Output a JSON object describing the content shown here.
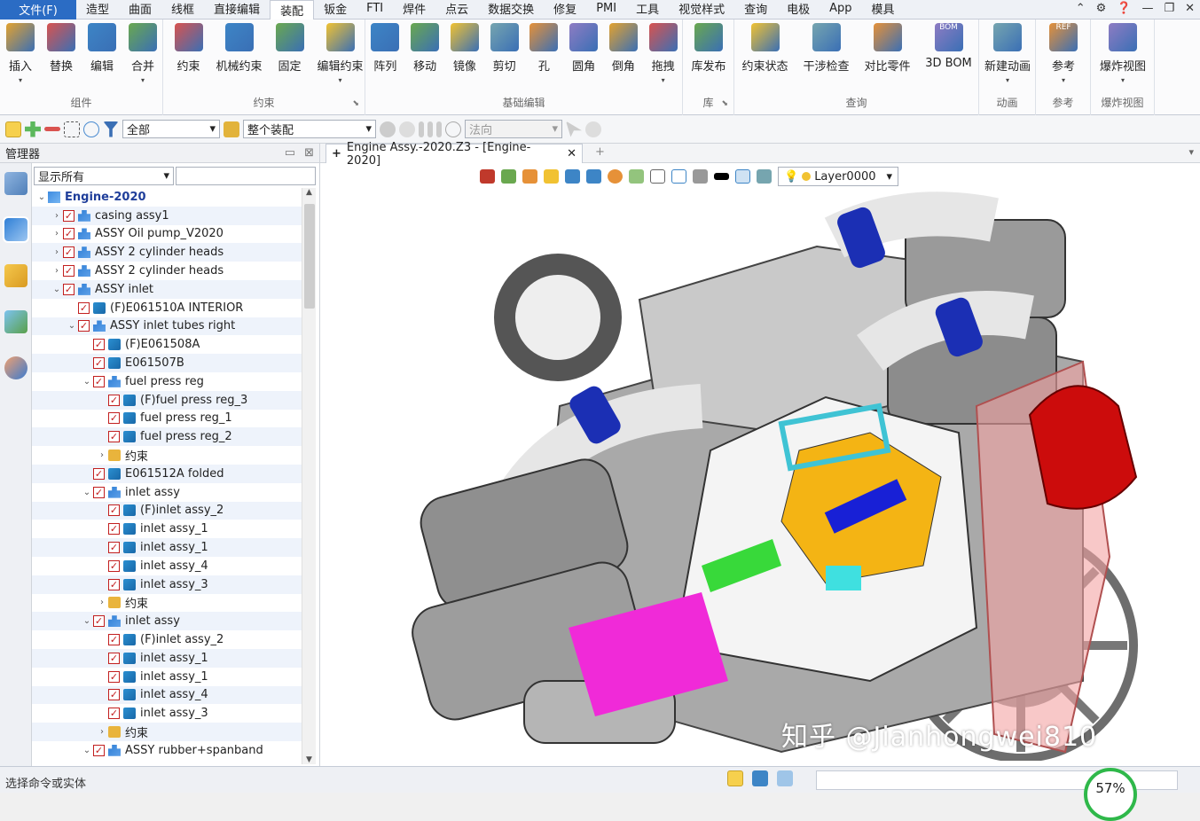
{
  "menubar": {
    "file": "文件(F)",
    "tabs": [
      "造型",
      "曲面",
      "线框",
      "直接编辑",
      "装配",
      "钣金",
      "FTI",
      "焊件",
      "点云",
      "数据交换",
      "修复",
      "PMI",
      "工具",
      "视觉样式",
      "查询",
      "电极",
      "App",
      "模具"
    ],
    "active_index": 4
  },
  "ribbon": {
    "groups": [
      {
        "label": "组件",
        "buttons": [
          "插入",
          "替换",
          "编辑",
          "合并"
        ]
      },
      {
        "label": "约束",
        "buttons": [
          "约束",
          "机械约束",
          "固定",
          "编辑约束"
        ]
      },
      {
        "label": "基础编辑",
        "buttons": [
          "阵列",
          "移动",
          "镜像",
          "剪切",
          "孔",
          "圆角",
          "倒角",
          "拖拽"
        ]
      },
      {
        "label": "库",
        "buttons": [
          "库发布"
        ]
      },
      {
        "label": "查询",
        "buttons": [
          "约束状态",
          "干涉检查",
          "对比零件",
          "3D BOM"
        ]
      },
      {
        "label": "动画",
        "buttons": [
          "新建动画"
        ]
      },
      {
        "label": "参考",
        "buttons": [
          "参考"
        ]
      },
      {
        "label": "爆炸视图",
        "buttons": [
          "爆炸视图"
        ]
      }
    ],
    "bom_icon_text": "BOM",
    "ref_icon_text": "REF"
  },
  "toolbar2": {
    "filter_value": "全部",
    "scope_value": "整个装配",
    "direction_placeholder": "法向"
  },
  "manager": {
    "title": "管理器",
    "filter_value": "显示所有"
  },
  "tree": [
    {
      "label": "Engine-2020",
      "level": 0,
      "icon": "root",
      "expand": "v",
      "check": false
    },
    {
      "label": "casing assy1",
      "level": 1,
      "icon": "assy",
      "expand": ">",
      "check": true
    },
    {
      "label": "ASSY Oil pump_V2020",
      "level": 1,
      "icon": "assy",
      "expand": ">",
      "check": true
    },
    {
      "label": "ASSY 2 cylinder heads",
      "level": 1,
      "icon": "assy",
      "expand": ">",
      "check": true
    },
    {
      "label": "ASSY 2 cylinder heads",
      "level": 1,
      "icon": "assy",
      "expand": ">",
      "check": true
    },
    {
      "label": "ASSY inlet",
      "level": 1,
      "icon": "assy",
      "expand": "v",
      "check": true
    },
    {
      "label": "(F)E061510A INTERIOR",
      "level": 2,
      "icon": "part",
      "expand": "",
      "check": true
    },
    {
      "label": "ASSY inlet tubes right",
      "level": 2,
      "icon": "assy",
      "expand": "v",
      "check": true
    },
    {
      "label": "(F)E061508A",
      "level": 3,
      "icon": "part",
      "expand": "",
      "check": true
    },
    {
      "label": "E061507B",
      "level": 3,
      "icon": "part",
      "expand": "",
      "check": true
    },
    {
      "label": "fuel press reg",
      "level": 3,
      "icon": "assy",
      "expand": "v",
      "check": true
    },
    {
      "label": "(F)fuel press reg_3",
      "level": 4,
      "icon": "part",
      "expand": "",
      "check": true
    },
    {
      "label": "fuel press reg_1",
      "level": 4,
      "icon": "part",
      "expand": "",
      "check": true
    },
    {
      "label": "fuel press reg_2",
      "level": 4,
      "icon": "part",
      "expand": "",
      "check": true
    },
    {
      "label": "约束",
      "level": 4,
      "icon": "folder",
      "expand": ">",
      "check": false
    },
    {
      "label": "E061512A folded",
      "level": 3,
      "icon": "part",
      "expand": "",
      "check": true
    },
    {
      "label": "inlet assy",
      "level": 3,
      "icon": "assy",
      "expand": "v",
      "check": true
    },
    {
      "label": "(F)inlet assy_2",
      "level": 4,
      "icon": "part",
      "expand": "",
      "check": true
    },
    {
      "label": "inlet assy_1",
      "level": 4,
      "icon": "part",
      "expand": "",
      "check": true
    },
    {
      "label": "inlet assy_1",
      "level": 4,
      "icon": "part",
      "expand": "",
      "check": true
    },
    {
      "label": "inlet assy_4",
      "level": 4,
      "icon": "part",
      "expand": "",
      "check": true
    },
    {
      "label": "inlet assy_3",
      "level": 4,
      "icon": "part",
      "expand": "",
      "check": true
    },
    {
      "label": "约束",
      "level": 4,
      "icon": "folder",
      "expand": ">",
      "check": false
    },
    {
      "label": "inlet assy",
      "level": 3,
      "icon": "assy",
      "expand": "v",
      "check": true
    },
    {
      "label": "(F)inlet assy_2",
      "level": 4,
      "icon": "part",
      "expand": "",
      "check": true
    },
    {
      "label": "inlet assy_1",
      "level": 4,
      "icon": "part",
      "expand": "",
      "check": true
    },
    {
      "label": "inlet assy_1",
      "level": 4,
      "icon": "part",
      "expand": "",
      "check": true
    },
    {
      "label": "inlet assy_4",
      "level": 4,
      "icon": "part",
      "expand": "",
      "check": true
    },
    {
      "label": "inlet assy_3",
      "level": 4,
      "icon": "part",
      "expand": "",
      "check": true
    },
    {
      "label": "约束",
      "level": 4,
      "icon": "folder",
      "expand": ">",
      "check": false
    },
    {
      "label": "ASSY rubber+spanband",
      "level": 3,
      "icon": "assy",
      "expand": "v",
      "check": true
    }
  ],
  "viewport": {
    "doc_tab": "Engine Assy.-2020.Z3 - [Engine-2020]",
    "layer": "Layer0000",
    "watermark": "知乎 @Jianhongwei810"
  },
  "status": {
    "prompt": "选择命令或实体",
    "zoom": "57%"
  },
  "colors": {
    "file_tab": "#2b6cc4",
    "check": "#c21f1f",
    "tree_root": "#1f3e9a",
    "zoom_ring": "#2fb84a"
  }
}
